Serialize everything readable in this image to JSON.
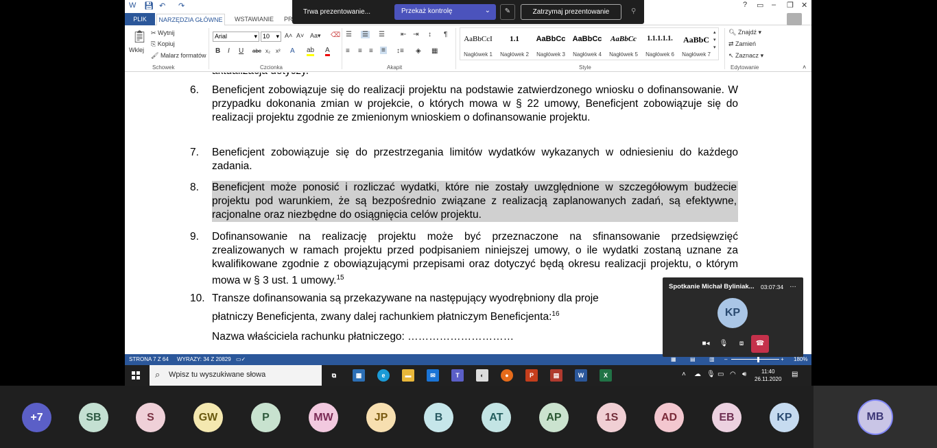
{
  "word": {
    "tabs": [
      "PLIK",
      "NARZĘDZIA GŁÓWNE",
      "WSTAWIANIE",
      "PR"
    ],
    "window_controls": [
      "?",
      "▭",
      "–",
      "❐",
      "✕"
    ],
    "clipboard": {
      "paste": "Wklej",
      "cut": "Wytnij",
      "copy": "Kopiuj",
      "format_painter": "Malarz formatów",
      "label": "Schowek"
    },
    "font": {
      "name": "Arial",
      "size": "10",
      "label": "Czcionka"
    },
    "paragraph_label": "Akapit",
    "styles": [
      {
        "sample": "AaBbCcI",
        "name": "Nagłówek 1"
      },
      {
        "sample": "1.1",
        "name": "Nagłówek 2"
      },
      {
        "sample": "AaBbCc",
        "name": "Nagłówek 3"
      },
      {
        "sample": "AaBbCc",
        "name": "Nagłówek 4"
      },
      {
        "sample": "AaBbCc",
        "name": "Nagłówek 5"
      },
      {
        "sample": "1.1.1.1.1.",
        "name": "Nagłówek 6"
      },
      {
        "sample": "AaBbC",
        "name": "Nagłówek 7"
      }
    ],
    "styles_label": "Style",
    "editing": {
      "find": "Znajdź",
      "replace": "Zamień",
      "select": "Zaznacz",
      "label": "Edytowanie"
    },
    "status": {
      "page": "STRONA 7 Z 64",
      "words": "WYRAZY: 34 Z 20829",
      "zoom": "180%"
    }
  },
  "presentation_bar": {
    "status": "Trwa prezentowanie...",
    "give_control": "Przekaż kontrolę",
    "stop": "Zatrzymaj prezentowanie"
  },
  "document": {
    "top_fragment": "aktualizacja dotyczy.",
    "items": [
      {
        "num": "6.",
        "text": "Beneficjent zobowiązuje się do realizacji projektu na podstawie zatwierdzonego wniosku o dofinansowanie. W przypadku dokonania zmian w projekcie, o których mowa w § 22 umowy, Beneficjent zobowiązuje się do realizacji projektu zgodnie ze zmienionym wnioskiem o dofinansowanie projektu."
      },
      {
        "num": "7.",
        "text": "Beneficjent zobowiązuje się do przestrzegania limitów wydatków wykazanych w odniesieniu do każdego zadania."
      },
      {
        "num": "8.",
        "text": "Beneficjent może ponosić i rozliczać wydatki, które nie zostały uwzględnione w szczegółowym budżecie projektu pod warunkiem, że są bezpośrednio związane z realizacją zaplanowanych zadań, są efektywne, racjonalne oraz niezbędne do osiągnięcia celów projektu."
      },
      {
        "num": "9.",
        "text": "Dofinansowanie na realizację projektu może być przeznaczone na sfinansowanie przedsięwzięć zrealizowanych w ramach projektu przed podpisaniem niniejszej umowy, o ile wydatki zostaną uznane za kwalifikowane zgodnie z obowiązującymi przepisami oraz dotyczyć będą okresu realizacji projektu, o którym mowa w § 3 ust. 1 umowy.",
        "footnote": "15"
      },
      {
        "num": "10.",
        "text_line1": "Transze dofinansowania są przekazywane na następujący wyodrębniony dla proje",
        "text_line2": "płatniczy Beneficjenta, zwany dalej rachunkiem płatniczym Beneficjenta:",
        "footnote": "16"
      }
    ],
    "owner_line": "Nazwa właściciela rachunku płatniczego: …………………………"
  },
  "taskbar": {
    "search_placeholder": "Wpisz tu wyszukiwane słowa",
    "time": "11:40",
    "date": "26.11.2020"
  },
  "meeting": {
    "title": "Spotkanie Michał Byliniak...",
    "duration": "03:07:34",
    "avatar": "KP"
  },
  "participants": [
    {
      "initials": "+7",
      "bg": "#5b5fc7",
      "fg": "#ffffff"
    },
    {
      "initials": "SB",
      "bg": "#c4e0d2",
      "fg": "#2f5a44"
    },
    {
      "initials": "S",
      "bg": "#efd0d8",
      "fg": "#7a3344"
    },
    {
      "initials": "GW",
      "bg": "#f4e8b0",
      "fg": "#6a5a10"
    },
    {
      "initials": "P",
      "bg": "#c8e2cf",
      "fg": "#2f5a3c"
    },
    {
      "initials": "MW",
      "bg": "#f2c9df",
      "fg": "#7a2a55"
    },
    {
      "initials": "JP",
      "bg": "#f7dfb0",
      "fg": "#7a5a10"
    },
    {
      "initials": "B",
      "bg": "#c6e6ea",
      "fg": "#2a5a62"
    },
    {
      "initials": "AT",
      "bg": "#c3e4e4",
      "fg": "#235c5c"
    },
    {
      "initials": "AP",
      "bg": "#cbe3cf",
      "fg": "#2b5833"
    },
    {
      "initials": "1S",
      "bg": "#f0cfd4",
      "fg": "#73303c"
    },
    {
      "initials": "AD",
      "bg": "#f3c7cf",
      "fg": "#7a2a38"
    },
    {
      "initials": "EB",
      "bg": "#ecd1e0",
      "fg": "#6e2f52"
    },
    {
      "initials": "KP",
      "bg": "#c6dbf0",
      "fg": "#2a4a70"
    }
  ],
  "self": {
    "initials": "MB"
  }
}
